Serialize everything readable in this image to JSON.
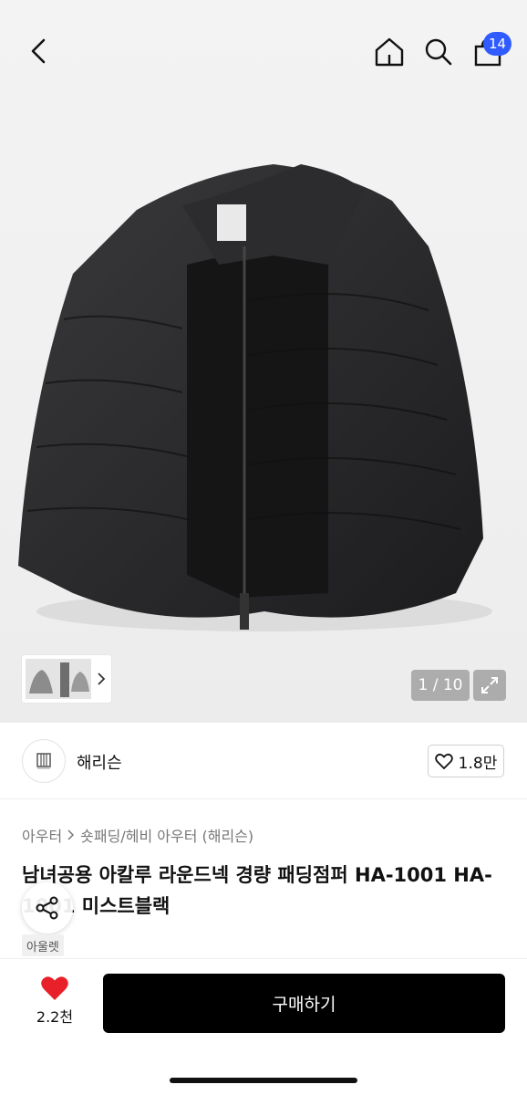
{
  "header": {
    "back_icon": "chevron-left-icon",
    "home_icon": "home-icon",
    "search_icon": "search-icon",
    "bag_icon": "shopping-bag-icon",
    "bag_badge": "14",
    "badge_color": "#2f5bff"
  },
  "gallery": {
    "page_indicator": "1 / 10",
    "expand_icon": "expand-icon",
    "thumbnail_chevron": "chevron-right-icon"
  },
  "seller": {
    "name": "해리슨",
    "like_icon": "heart-outline-icon",
    "like_count": "1.8만"
  },
  "product": {
    "breadcrumb": [
      "아우터",
      "숏패딩/헤비 아우터 (해리슨)"
    ],
    "title": "남녀공용 아칼루 라운드넥 경량 패딩점퍼 HA-1001 HA-1001 미스트블랙",
    "tag": "아울렛"
  },
  "footer": {
    "wish_icon": "heart-filled-icon",
    "wish_count": "2.2천",
    "wish_color": "#e8202a",
    "buy_label": "구매하기"
  }
}
